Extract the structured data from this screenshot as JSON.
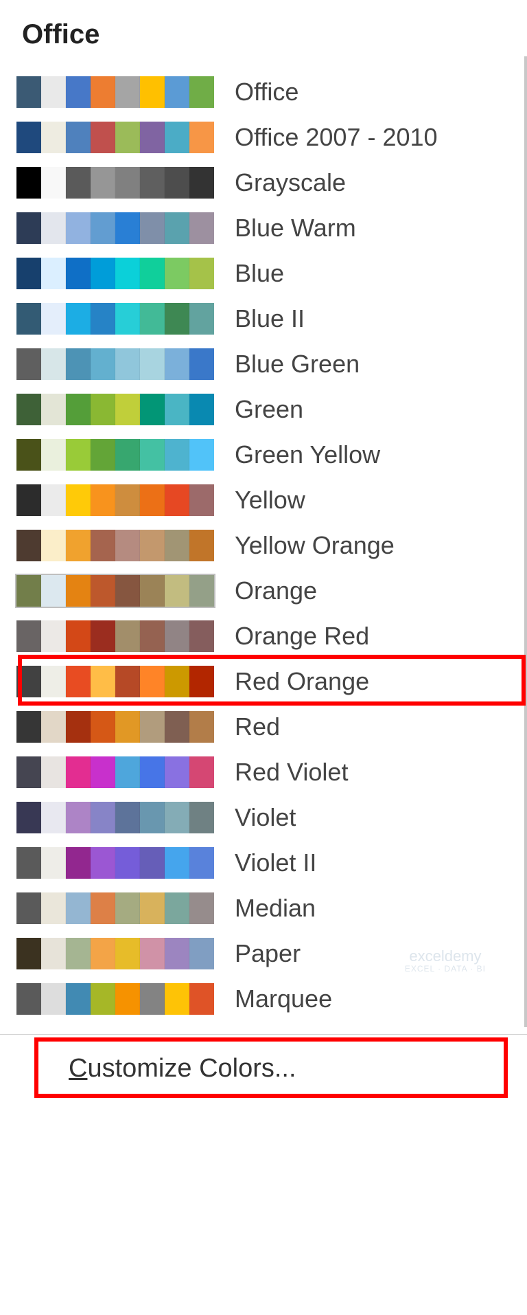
{
  "section_header": "Office",
  "customize_label": "Customize Colors...",
  "watermark": {
    "line1": "exceldemy",
    "line2": "EXCEL · DATA · BI"
  },
  "themes": [
    {
      "name": "Office",
      "swatches": [
        "#3b5a74",
        "#e9e9e9",
        "#4778c8",
        "#ed7d31",
        "#a5a5a5",
        "#ffc000",
        "#5b9bd5",
        "#70ad47"
      ]
    },
    {
      "name": "Office 2007 - 2010",
      "swatches": [
        "#1f497d",
        "#eeece1",
        "#4f81bd",
        "#c0504d",
        "#9bbb59",
        "#8064a2",
        "#4bacc6",
        "#f79646"
      ]
    },
    {
      "name": "Grayscale",
      "swatches": [
        "#000000",
        "#f8f8f8",
        "#5a5a5a",
        "#969696",
        "#808080",
        "#5f5f5f",
        "#4d4d4d",
        "#333333"
      ]
    },
    {
      "name": "Blue Warm",
      "swatches": [
        "#2d3c56",
        "#e3e6ed",
        "#91b2e0",
        "#629dd1",
        "#297fd5",
        "#7f8fa9",
        "#5aa2ae",
        "#9d90a0"
      ]
    },
    {
      "name": "Blue",
      "swatches": [
        "#17406d",
        "#dbefff",
        "#0f6fc6",
        "#009dd9",
        "#0bd0d9",
        "#10cf9b",
        "#7cca62",
        "#a5c249"
      ]
    },
    {
      "name": "Blue II",
      "swatches": [
        "#335b74",
        "#e4eefb",
        "#1cade4",
        "#2683c6",
        "#27ced7",
        "#42ba97",
        "#3e8853",
        "#62a39f"
      ]
    },
    {
      "name": "Blue Green",
      "swatches": [
        "#5f5f5f",
        "#d7e6e8",
        "#4d93b5",
        "#63b0cf",
        "#90c6db",
        "#a8d4e0",
        "#7bb0da",
        "#3a78c9"
      ]
    },
    {
      "name": "Green",
      "swatches": [
        "#3e6137",
        "#e3e5d6",
        "#549e39",
        "#8ab833",
        "#c0cf3a",
        "#029676",
        "#4ab5c4",
        "#0989b1"
      ]
    },
    {
      "name": "Green Yellow",
      "swatches": [
        "#4a5219",
        "#eaf0dd",
        "#99cb38",
        "#63a537",
        "#37a76f",
        "#44c1a3",
        "#4eb3cf",
        "#51c3f9"
      ]
    },
    {
      "name": "Yellow",
      "swatches": [
        "#2c2c2c",
        "#ebebeb",
        "#ffca08",
        "#f8931d",
        "#ce8d3e",
        "#ec7016",
        "#e64823",
        "#9c6a6a"
      ]
    },
    {
      "name": "Yellow Orange",
      "swatches": [
        "#4e3b30",
        "#fbeec9",
        "#f0a22e",
        "#a5644e",
        "#b58b80",
        "#c3986d",
        "#a19574",
        "#c17529"
      ]
    },
    {
      "name": "Orange",
      "swatches": [
        "#727e4a",
        "#dce8ef",
        "#e48312",
        "#bd582c",
        "#865640",
        "#9b8357",
        "#c2bc80",
        "#94a088"
      ],
      "hovered": true
    },
    {
      "name": "Orange Red",
      "swatches": [
        "#696464",
        "#ece9e6",
        "#d34817",
        "#9b2d1f",
        "#a28e6a",
        "#956251",
        "#918485",
        "#855d5d"
      ]
    },
    {
      "name": "Red Orange",
      "swatches": [
        "#414141",
        "#eeeee7",
        "#e84c22",
        "#ffbd47",
        "#b64926",
        "#ff8427",
        "#cc9900",
        "#b22600"
      ],
      "highlighted": true
    },
    {
      "name": "Red",
      "swatches": [
        "#363636",
        "#e2d7c7",
        "#a5300f",
        "#d55816",
        "#e19825",
        "#b19c7d",
        "#7f5f52",
        "#b27d49"
      ]
    },
    {
      "name": "Red Violet",
      "swatches": [
        "#454551",
        "#e8e4e1",
        "#e32d91",
        "#c830cc",
        "#4ea6dc",
        "#4775e7",
        "#8971e1",
        "#d54773"
      ]
    },
    {
      "name": "Violet",
      "swatches": [
        "#383854",
        "#e8e8f0",
        "#ad84c6",
        "#8784c7",
        "#5d739a",
        "#6997af",
        "#84acb6",
        "#6f8183"
      ]
    },
    {
      "name": "Violet II",
      "swatches": [
        "#5a5a5a",
        "#eeede8",
        "#92278f",
        "#9b57d3",
        "#755dd9",
        "#665eb8",
        "#45a5ed",
        "#5982db"
      ]
    },
    {
      "name": "Median",
      "swatches": [
        "#5a5a5a",
        "#eae6da",
        "#94b6d2",
        "#dd8047",
        "#a5ab81",
        "#d8b25c",
        "#7ba79d",
        "#968c8c"
      ]
    },
    {
      "name": "Paper",
      "swatches": [
        "#3b3220",
        "#e7e3d9",
        "#a5b592",
        "#f3a447",
        "#e7bc29",
        "#d092a7",
        "#9c85c0",
        "#809ec2"
      ]
    },
    {
      "name": "Marquee",
      "swatches": [
        "#5a5a5a",
        "#dddddd",
        "#418ab3",
        "#a6b727",
        "#f69200",
        "#838383",
        "#fec306",
        "#df5327"
      ]
    }
  ]
}
